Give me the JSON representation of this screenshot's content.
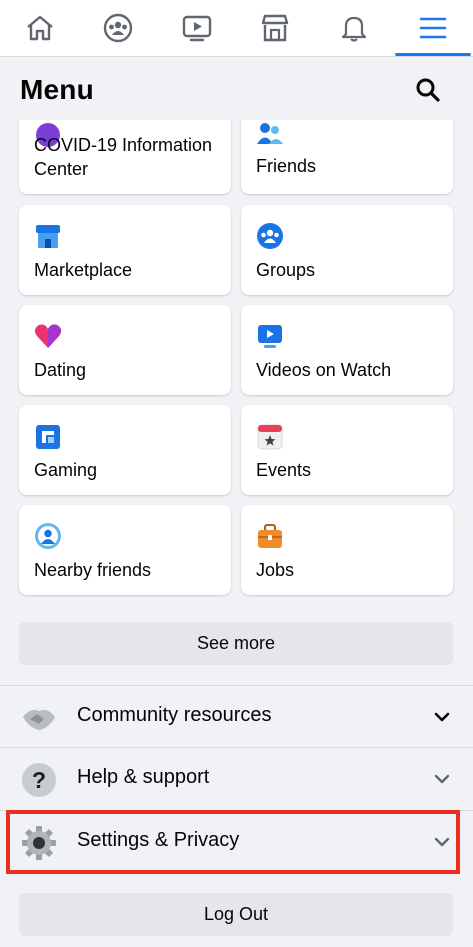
{
  "nav": {
    "tabs": [
      {
        "name": "home-icon"
      },
      {
        "name": "groups-icon"
      },
      {
        "name": "watch-icon"
      },
      {
        "name": "marketplace-icon"
      },
      {
        "name": "bell-icon"
      },
      {
        "name": "menu-icon"
      }
    ],
    "active_color": "#1877f2"
  },
  "header": {
    "title": "Menu"
  },
  "shortcuts": [
    {
      "label": "COVID-19 Information Center",
      "icon": "covid-info-icon"
    },
    {
      "label": "Friends",
      "icon": "friends-icon"
    },
    {
      "label": "Marketplace",
      "icon": "marketplace-icon"
    },
    {
      "label": "Groups",
      "icon": "groups-icon"
    },
    {
      "label": "Dating",
      "icon": "dating-icon"
    },
    {
      "label": "Videos on Watch",
      "icon": "watch-icon"
    },
    {
      "label": "Gaming",
      "icon": "gaming-icon"
    },
    {
      "label": "Events",
      "icon": "events-icon"
    },
    {
      "label": "Nearby friends",
      "icon": "nearby-friends-icon"
    },
    {
      "label": "Jobs",
      "icon": "jobs-icon"
    }
  ],
  "see_more_label": "See more",
  "sections": [
    {
      "label": "Community resources",
      "icon": "handshake-icon"
    },
    {
      "label": "Help & support",
      "icon": "question-icon"
    },
    {
      "label": "Settings & Privacy",
      "icon": "gear-icon"
    }
  ],
  "logout_label": "Log Out",
  "colors": {
    "highlight": "#ee2d22",
    "background": "#f0f2f5"
  }
}
